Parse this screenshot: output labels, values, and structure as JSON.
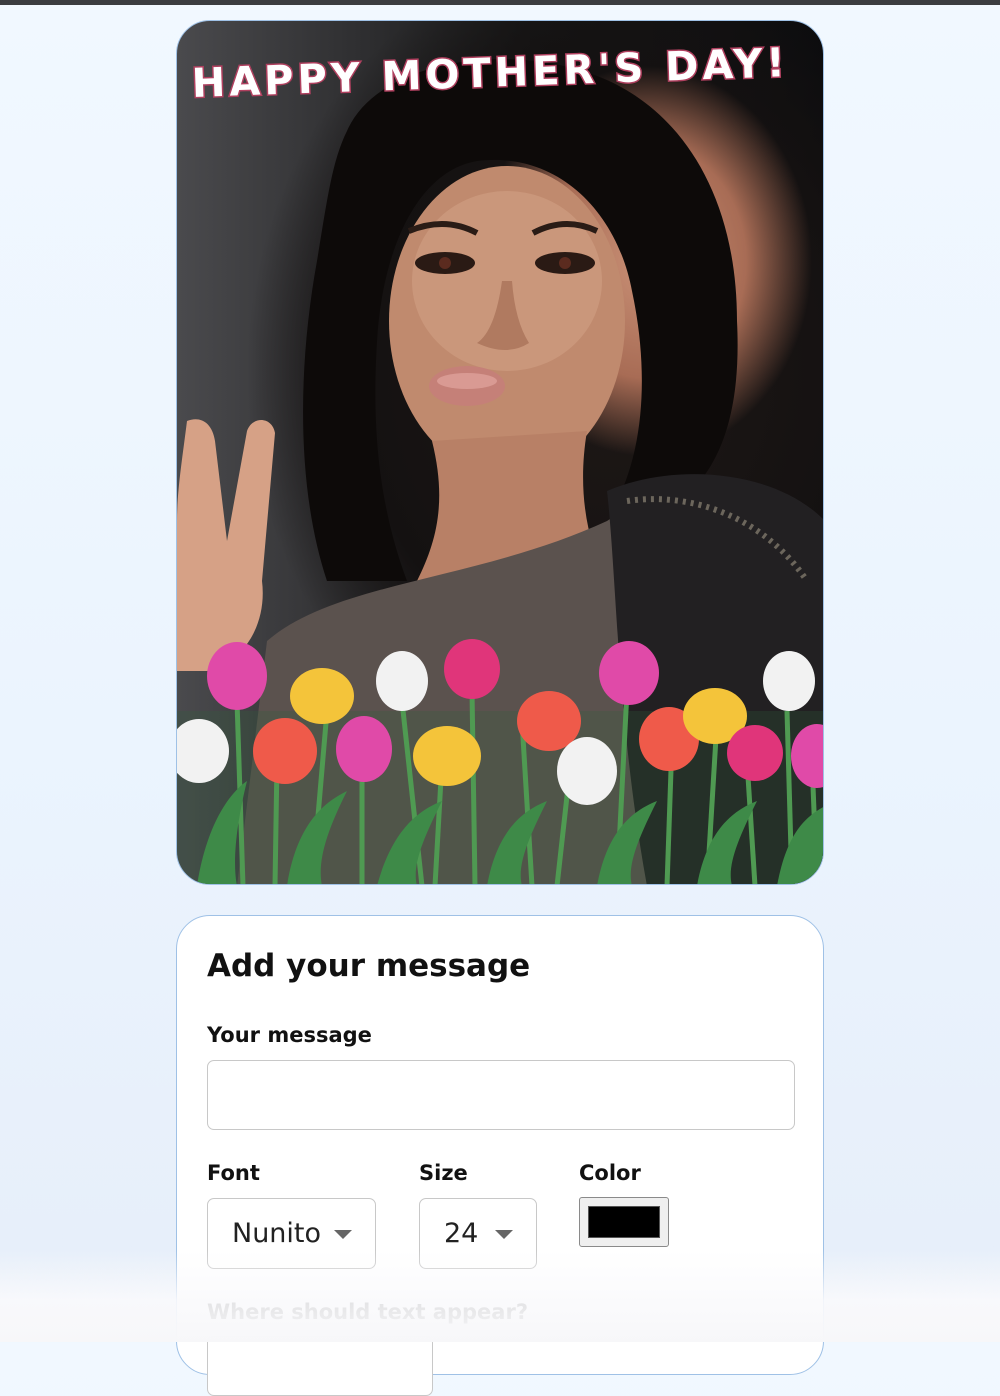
{
  "card": {
    "greeting": "HAPPY MOTHER'S DAY!",
    "greeting_color": "#b0405f"
  },
  "form": {
    "title": "Add your message",
    "message_label": "Your message",
    "message_value": "",
    "font_label": "Font",
    "font_value": "Nunito",
    "size_label": "Size",
    "size_value": "24",
    "color_label": "Color",
    "color_value": "#000000",
    "position_label": "Where should text appear?"
  },
  "icons": {
    "dropdown": "chevron-down-icon"
  },
  "colors": {
    "panel_border": "#9fc1e6",
    "page_bg": "#eef5fe"
  }
}
